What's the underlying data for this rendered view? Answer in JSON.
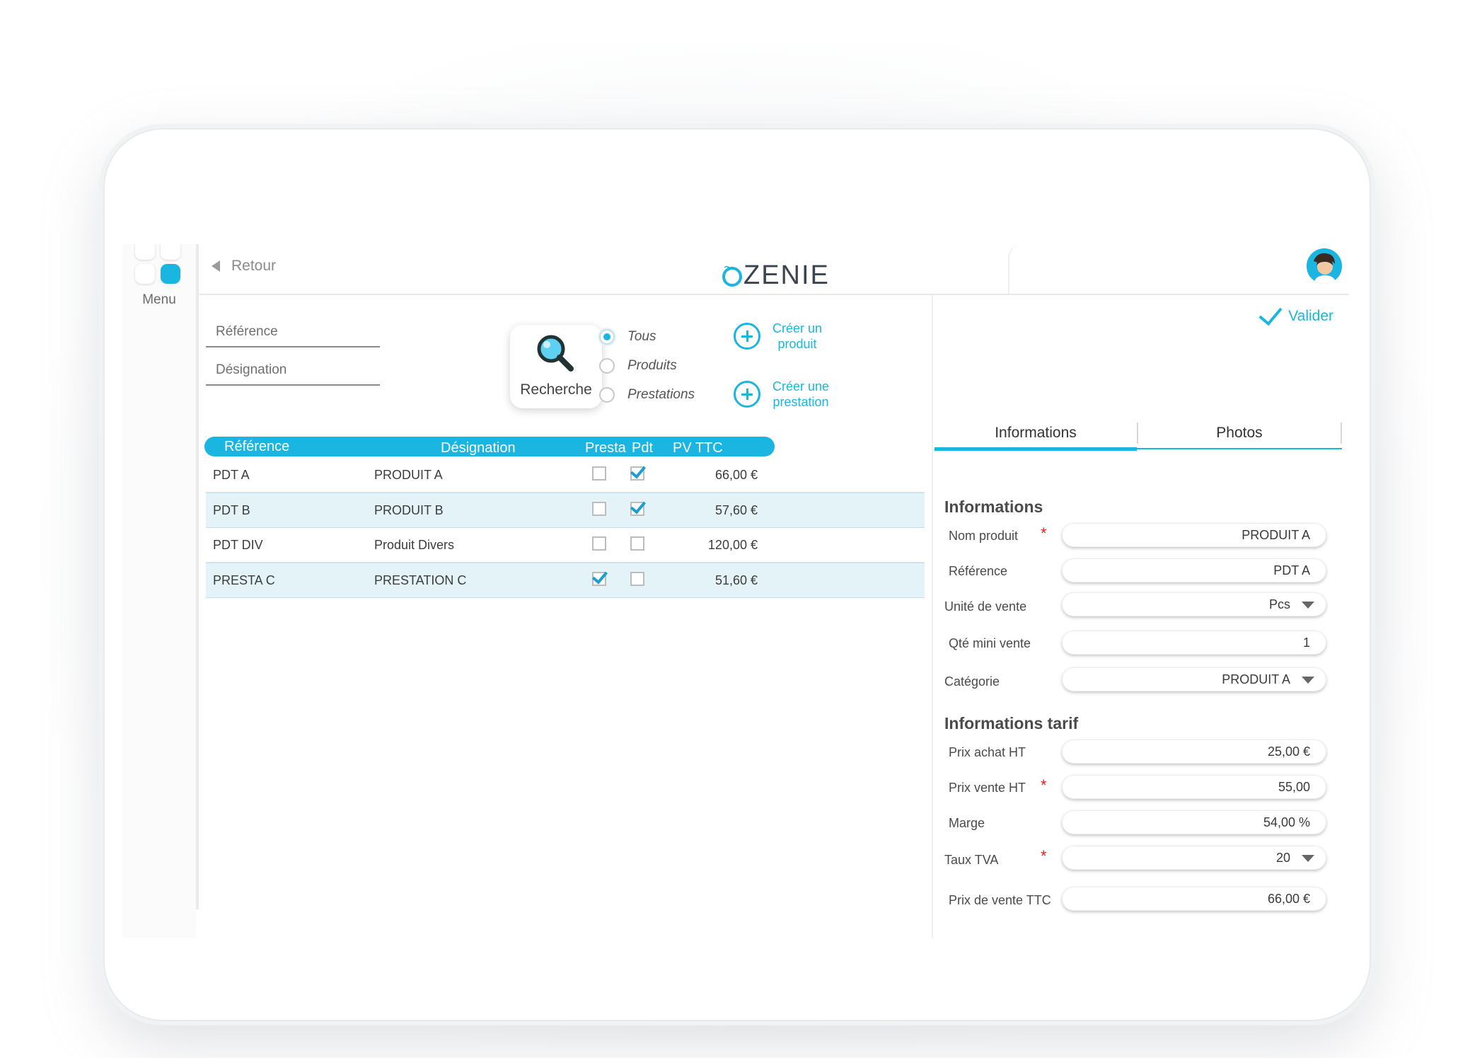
{
  "app": {
    "logo_text": "ZENIE",
    "menu_label": "Menu",
    "back_label": "Retour",
    "avatar_icon": "user-avatar-icon",
    "accent_color": "#1ab5e0"
  },
  "search": {
    "reference_placeholder": "Référence",
    "designation_placeholder": "Désignation",
    "search_button_label": "Recherche",
    "search_icon": "magnifier-icon",
    "filter_options": [
      {
        "label": "Tous",
        "checked": true
      },
      {
        "label": "Produits",
        "checked": false
      },
      {
        "label": "Prestations",
        "checked": false
      }
    ],
    "create_product_label": "Créer un produit",
    "create_service_label": "Créer une prestation"
  },
  "table": {
    "headers": [
      "Référence",
      "Désignation",
      "Presta",
      "Pdt",
      "PV TTC"
    ],
    "rows": [
      {
        "reference": "PDT A",
        "designation": "PRODUIT A",
        "presta": false,
        "pdt": true,
        "pv_ttc": "66,00 €"
      },
      {
        "reference": "PDT B",
        "designation": "PRODUIT B",
        "presta": false,
        "pdt": true,
        "pv_ttc": "57,60 €"
      },
      {
        "reference": "PDT DIV",
        "designation": "Produit Divers",
        "presta": false,
        "pdt": false,
        "pv_ttc": "120,00 €"
      },
      {
        "reference": "PRESTA C",
        "designation": "PRESTATION C",
        "presta": true,
        "pdt": false,
        "pv_ttc": "51,60 €"
      }
    ]
  },
  "detail": {
    "validate_label": "Valider",
    "tabs": [
      "Informations",
      "Photos"
    ],
    "active_tab": "Informations",
    "section_info_title": "Informations",
    "section_tarif_title": "Informations tarif",
    "info_fields": [
      {
        "label": "Nom produit",
        "value": "PRODUIT A",
        "required": true,
        "dropdown": false
      },
      {
        "label": "Référence",
        "value": "PDT A",
        "required": false,
        "dropdown": false
      },
      {
        "label": "Unité de vente",
        "value": "Pcs",
        "required": false,
        "dropdown": true
      },
      {
        "label": "Qté mini vente",
        "value": "1",
        "required": false,
        "dropdown": false
      },
      {
        "label": "Catégorie",
        "value": "PRODUIT A",
        "required": false,
        "dropdown": true
      }
    ],
    "tarif_fields": [
      {
        "label": "Prix achat HT",
        "value": "25,00 €",
        "required": false,
        "dropdown": false
      },
      {
        "label": "Prix vente HT",
        "value": "55,00",
        "required": true,
        "dropdown": false
      },
      {
        "label": "Marge",
        "value": "54,00 %",
        "required": false,
        "dropdown": false
      },
      {
        "label": "Taux TVA",
        "value": "20",
        "required": true,
        "dropdown": true
      },
      {
        "label": "Prix de vente TTC",
        "value": "66,00 €",
        "required": false,
        "dropdown": false
      }
    ],
    "required_mark": "*"
  }
}
